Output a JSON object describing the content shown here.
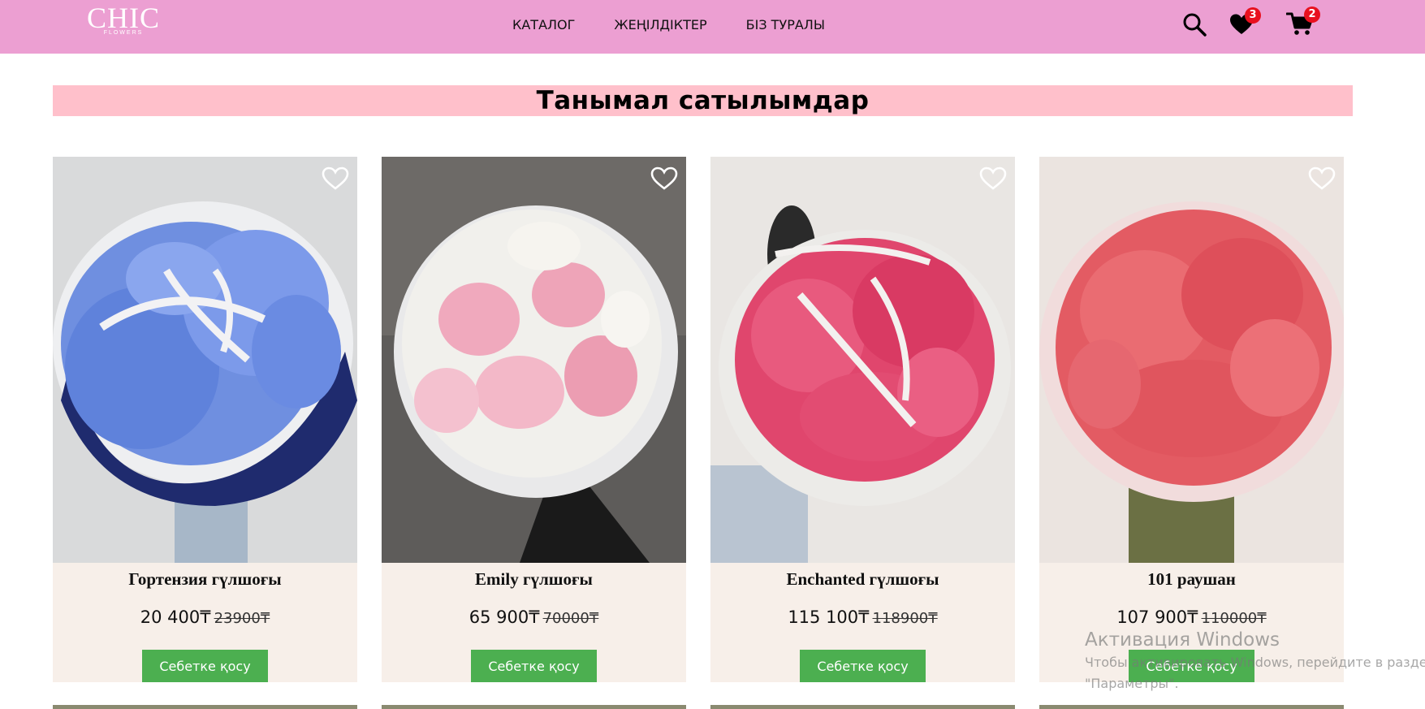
{
  "header": {
    "logo_text": "CHIC",
    "logo_subtext": "FLOWERS",
    "nav": [
      "КАТАЛОГ",
      "ЖЕҢІЛДІКТЕР",
      "БІЗ ТУРАЛЫ"
    ],
    "wishlist_count": "3",
    "cart_count": "2",
    "background_color": "#ec9fd2"
  },
  "section": {
    "title": "Танымал сатылымдар",
    "title_background": "#ffc0cb"
  },
  "products": [
    {
      "name": "Гортензия гүлшоғы",
      "price": "20 400₸",
      "old_price": "23900₸",
      "button": "Себетке қосу",
      "image": "blue-hydrangea-bouquet"
    },
    {
      "name": "Emily гүлшоғы",
      "price": "65 900₸",
      "old_price": "70000₸",
      "button": "Себетке қосу",
      "image": "pink-white-eustoma-bouquet"
    },
    {
      "name": "Enchanted гүлшоғы",
      "price": "115 100₸",
      "old_price": "118900₸",
      "button": "Себетке қосу",
      "image": "pink-spray-rose-bouquet"
    },
    {
      "name": "101 раушан",
      "price": "107 900₸",
      "old_price": "110000₸",
      "button": "Себетке қосу",
      "image": "coral-peony-rose-bouquet"
    }
  ],
  "watermark": {
    "title": "Активация Windows",
    "line1": "Чтобы активировать Windows, перейдите в раздел",
    "line2": "\"Параметры\"."
  },
  "colors": {
    "button": "#4caf50",
    "card_bg": "#f7efe9",
    "badge": "#e8101e"
  },
  "icons": [
    "search-icon",
    "heart-icon",
    "cart-icon"
  ]
}
